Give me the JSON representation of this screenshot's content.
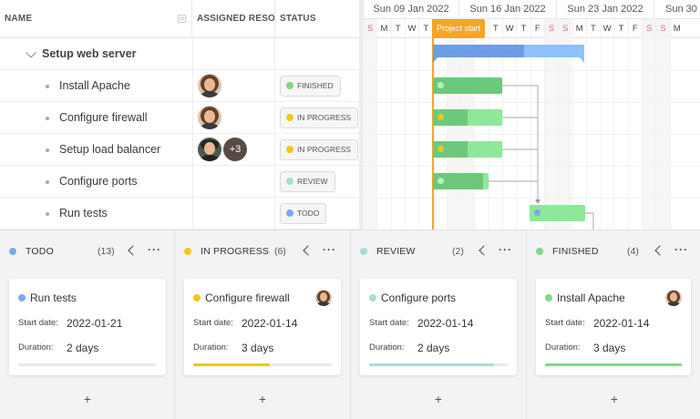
{
  "grid": {
    "headers": {
      "name": "NAME",
      "resources": "ASSIGNED RESO...",
      "status": "STATUS"
    },
    "parent_task": "Setup web server",
    "tasks": [
      {
        "name": "Install Apache",
        "status": "FINISHED",
        "status_color": "#7ed88a"
      },
      {
        "name": "Configure firewall",
        "status": "IN PROGRESS",
        "status_color": "#f5c518"
      },
      {
        "name": "Setup load balancer",
        "status": "IN PROGRESS",
        "status_color": "#f5c518",
        "extra_resources": "+3"
      },
      {
        "name": "Configure ports",
        "status": "REVIEW",
        "status_color": "#a8dcd6"
      },
      {
        "name": "Run tests",
        "status": "TODO",
        "status_color": "#78a9f0"
      }
    ]
  },
  "gantt": {
    "weeks": [
      "Sun 09 Jan 2022",
      "Sun 16 Jan 2022",
      "Sun 23 Jan 2022",
      "Sun 30 J"
    ],
    "days": [
      "S",
      "M",
      "T",
      "W",
      "T",
      "F",
      "S",
      "S",
      "M",
      "T",
      "W",
      "T",
      "F",
      "S",
      "S",
      "M",
      "T",
      "W",
      "T",
      "F",
      "S",
      "S",
      "M"
    ],
    "today_label": "Project start"
  },
  "kanban": {
    "columns": [
      {
        "title": "TODO",
        "count": "(13)",
        "color": "#78a9f0",
        "card": {
          "title": "Run tests",
          "start_label": "Start date:",
          "start": "2022-01-21",
          "duration_label": "Duration:",
          "duration": "2 days",
          "progress": 0,
          "bar_color": "#78a9f0"
        }
      },
      {
        "title": "IN PROGRESS",
        "count": "(6)",
        "color": "#f5c518",
        "card": {
          "title": "Configure firewall",
          "start_label": "Start date:",
          "start": "2022-01-14",
          "duration_label": "Duration:",
          "duration": "3 days",
          "progress": 0.55,
          "bar_color": "#f5c518"
        }
      },
      {
        "title": "REVIEW",
        "count": "(2)",
        "color": "#a8dcd6",
        "card": {
          "title": "Configure ports",
          "start_label": "Start date:",
          "start": "2022-01-14",
          "duration_label": "Duration:",
          "duration": "2 days",
          "progress": 0.9,
          "bar_color": "#a8dcd6"
        }
      },
      {
        "title": "FINISHED",
        "count": "(4)",
        "color": "#7ed88a",
        "card": {
          "title": "Install Apache",
          "start_label": "Start date:",
          "start": "2022-01-14",
          "duration_label": "Duration:",
          "duration": "3 days",
          "progress": 1,
          "bar_color": "#7ed88a"
        }
      }
    ],
    "add_label": "+"
  },
  "icons": {
    "sort": "sort-icon",
    "expand": "chevron-down-icon",
    "collapse": "chevron-left-icon",
    "menu": "more-dots-icon"
  }
}
